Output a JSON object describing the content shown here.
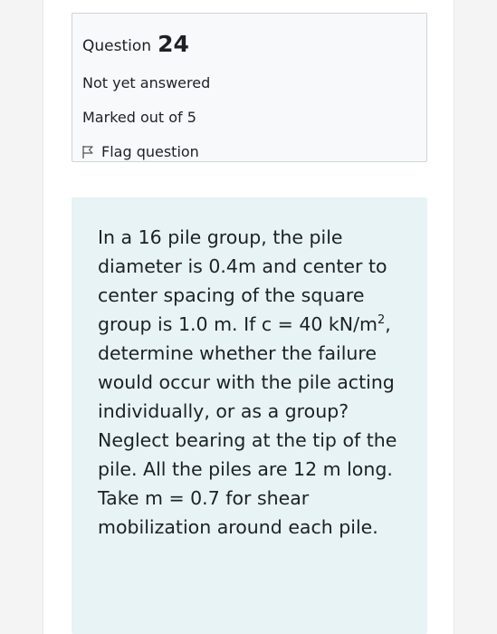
{
  "question_info": {
    "label": "Question",
    "number": "24",
    "state": "Not yet answered",
    "grade": "Marked out of 5",
    "flag_label": "Flag question"
  },
  "question": {
    "text_before": "In a 16 pile group, the pile diameter is 0.4m and center to center spacing of the square group is 1.0 m. If c = 40 kN/m",
    "superscript": "2",
    "text_after": ", determine whether the failure would occur with the pile acting individually, or as a group? Neglect bearing at the tip of the pile. All the piles are 12 m long. Take m = 0.7 for shear mobilization around each pile."
  },
  "colors": {
    "info_bg": "#f8f9fa",
    "content_bg": "#e7f3f5",
    "text": "#1d2125"
  },
  "icons": {
    "flag": "flag-outline-icon"
  }
}
